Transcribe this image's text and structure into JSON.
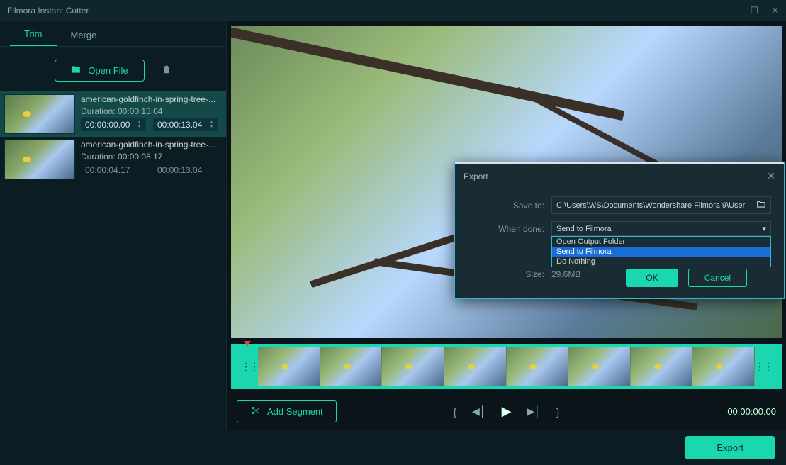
{
  "window": {
    "title": "Filmora Instant Cutter"
  },
  "tabs": {
    "trim": "Trim",
    "merge": "Merge"
  },
  "open_button": "Open File",
  "clips": [
    {
      "name": "american-goldfinch-in-spring-tree-...",
      "duration_label": "Duration: 00:00:13.04",
      "start": "00:00:00.00",
      "end": "00:00:13.04",
      "selected": true
    },
    {
      "name": "american-goldfinch-in-spring-tree-...",
      "duration_label": "Duration: 00:00:08.17",
      "start": "00:00:04.17",
      "end": "00:00:13.04",
      "selected": false
    }
  ],
  "add_segment": "Add Segment",
  "playhead_time": "00:00:00.00",
  "export_button": "Export",
  "export_dialog": {
    "title": "Export",
    "save_to_label": "Save to:",
    "save_to_path": "C:\\Users\\WS\\Documents\\Wondershare Filmora 9\\User",
    "when_done_label": "When done:",
    "when_done_value": "Send to Filmora",
    "when_done_options": [
      "Open Output Folder",
      "Send to Filmora",
      "Do Nothing"
    ],
    "size_label": "Size:",
    "size_value": "29.6MB",
    "ok": "OK",
    "cancel": "Cancel"
  }
}
